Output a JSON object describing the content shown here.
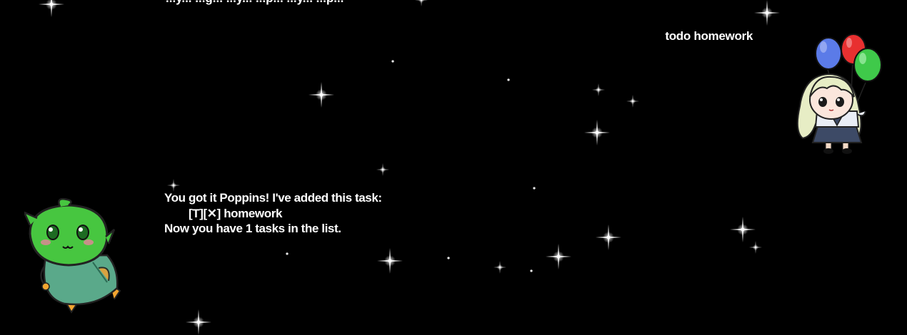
{
  "window": {
    "background": "#000000"
  },
  "conversation": {
    "clipped_previous_message": "...y... ...g... ...y... ...p... ...y... ...p...",
    "user_message": {
      "text": "todo homework",
      "avatar_icon": "girl-with-balloons-icon"
    },
    "bot_message": {
      "line1": "You got it Poppins! I've added this task:",
      "line2": "[T][✕] homework",
      "line3": "Now you have 1 tasks in the list.",
      "avatar_icon": "green-blob-creature-icon"
    }
  },
  "colors": {
    "text": "#ffffff",
    "balloon_blue": "#5b7be8",
    "balloon_red": "#e83030",
    "balloon_green": "#3fc94a",
    "creature_green": "#47c640",
    "creature_body": "#5aa98a"
  }
}
